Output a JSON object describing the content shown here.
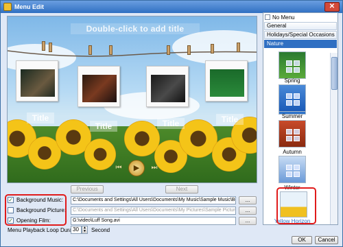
{
  "window": {
    "title": "Menu Edit"
  },
  "preview": {
    "title_placeholder": "Double-click to add title",
    "thumbnail_titles": [
      "Title",
      "Title",
      "Title",
      "Title"
    ]
  },
  "nav": {
    "previous_label": "Previous",
    "next_label": "Next"
  },
  "settings": {
    "background_music": {
      "label": "Background Music:",
      "checked": true,
      "value": "C:\\Documents and Settings\\All Users\\Documents\\My Music\\Sample Music\\Beethoven"
    },
    "background_picture": {
      "label": "Background Picture:",
      "checked": false,
      "value": "C:\\Documents and Settings\\All Users\\Documents\\My Pictures\\Sample Pictures\\W"
    },
    "opening_film": {
      "label": "Opening Film:",
      "checked": true,
      "value": "G:\\video\\Luff Song.avi"
    },
    "browse_label": "...",
    "loop_duration_label": "Menu Playback Loop Duration:",
    "loop_duration_value": "30",
    "loop_duration_unit": "Second"
  },
  "templates": {
    "no_menu_label": "No Menu",
    "categories": [
      "General",
      "Holidays/Special Occasions",
      "Nature"
    ],
    "selected_category": "Nature",
    "items": [
      {
        "label": ""
      },
      {
        "label": "Spring"
      },
      {
        "label": "Summer"
      },
      {
        "label": "Autumn"
      },
      {
        "label": "Winter"
      },
      {
        "label": "Yellow Horizon"
      }
    ]
  },
  "buttons": {
    "ok_label": "OK",
    "cancel_label": "Cancel"
  },
  "colors": {
    "accent": "#2f6fc2",
    "highlight_red": "#e01a1a"
  }
}
